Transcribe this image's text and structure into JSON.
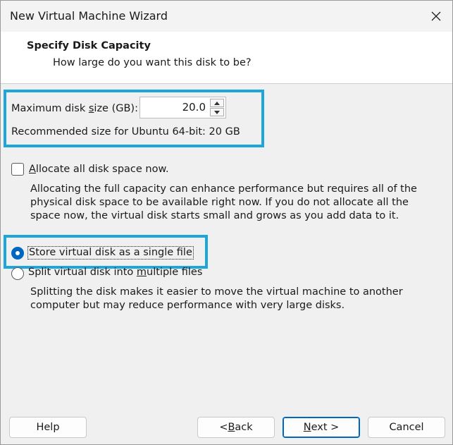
{
  "window": {
    "title": "New Virtual Machine Wizard",
    "close_icon": "close-icon"
  },
  "header": {
    "title": "Specify Disk Capacity",
    "subtitle": "How large do you want this disk to be?"
  },
  "disk": {
    "max_size_label_pre": "Maximum disk ",
    "max_size_label_accel": "s",
    "max_size_label_post": "ize (GB):",
    "max_size_value": "20.0",
    "recommended_label": "Recommended size for Ubuntu 64-bit: 20 GB"
  },
  "allocate": {
    "checked": false,
    "label_accel": "A",
    "label_rest": "llocate all disk space now.",
    "description": "Allocating the full capacity can enhance performance but requires all of the physical disk space to be available right now. If you do not allocate all the space now, the virtual disk starts small and grows as you add data to it."
  },
  "storage": {
    "single_file_label": "Store virtual disk as a single file",
    "single_file_selected": true,
    "multiple_files_pre": "Split virtual disk into ",
    "multiple_files_accel": "m",
    "multiple_files_post": "ultiple files",
    "multiple_files_selected": false,
    "multiple_description": "Splitting the disk makes it easier to move the virtual machine to another computer but may reduce performance with very large disks."
  },
  "buttons": {
    "help": "Help",
    "back_pre": "< ",
    "back_accel": "B",
    "back_post": "ack",
    "next_accel": "N",
    "next_post": "ext >",
    "cancel": "Cancel"
  },
  "colors": {
    "highlight": "#1ea6dc",
    "accent": "#0067c0"
  }
}
